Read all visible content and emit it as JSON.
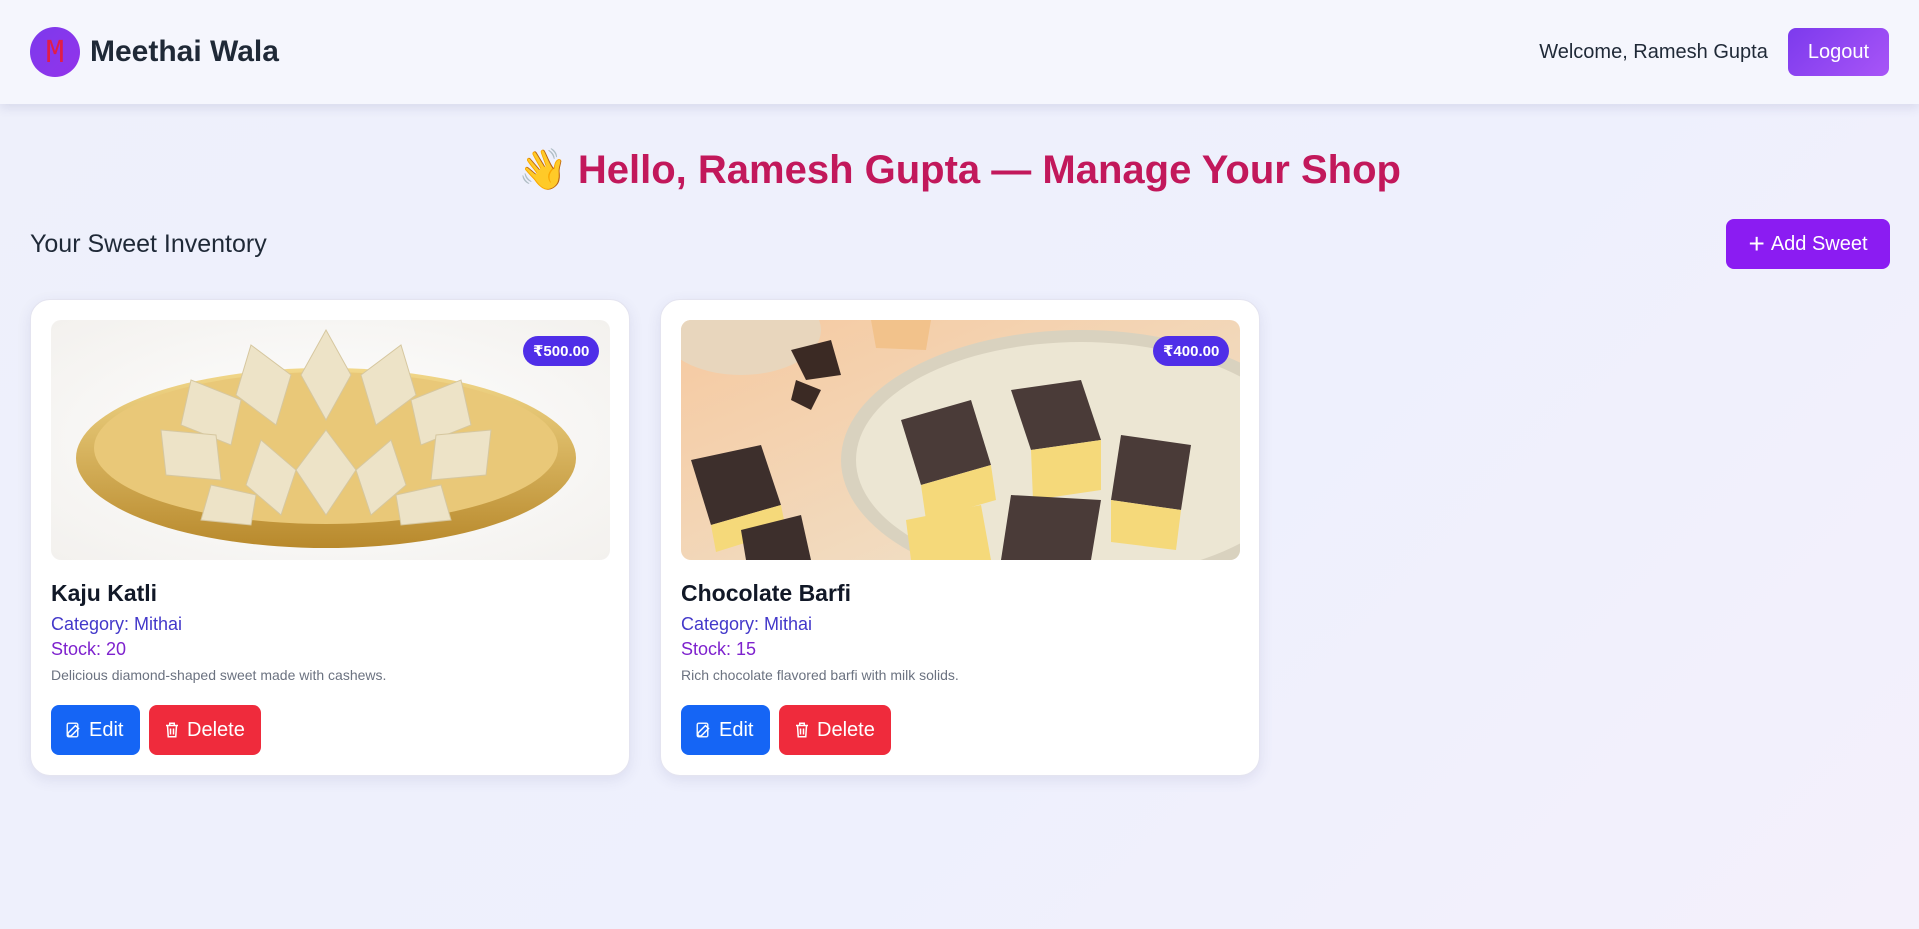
{
  "brand": {
    "logo_letter": "M",
    "name": "Meethai Wala"
  },
  "nav": {
    "welcome": "Welcome, Ramesh Gupta",
    "logout_label": "Logout"
  },
  "heading": {
    "emoji": "👋",
    "text": "Hello, Ramesh Gupta — Manage Your Shop"
  },
  "section": {
    "title": "Your Sweet Inventory",
    "add_label": "Add Sweet",
    "add_icon": "plus-icon"
  },
  "sweets": [
    {
      "name": "Kaju Katli",
      "price": "₹500.00",
      "category": "Category: Mithai",
      "stock": "Stock: 20",
      "description": "Delicious diamond-shaped sweet made with cashews.",
      "edit_label": "Edit",
      "delete_label": "Delete"
    },
    {
      "name": "Chocolate Barfi",
      "price": "₹400.00",
      "category": "Category: Mithai",
      "stock": "Stock: 15",
      "description": "Rich chocolate flavored barfi with milk solids.",
      "edit_label": "Edit",
      "delete_label": "Delete"
    }
  ],
  "colors": {
    "brand_purple": "#8b1cf2",
    "heading_pink": "#c2185b",
    "price_badge": "#4f2ee8",
    "edit_blue": "#1565f5",
    "delete_red": "#ef2b3c"
  }
}
